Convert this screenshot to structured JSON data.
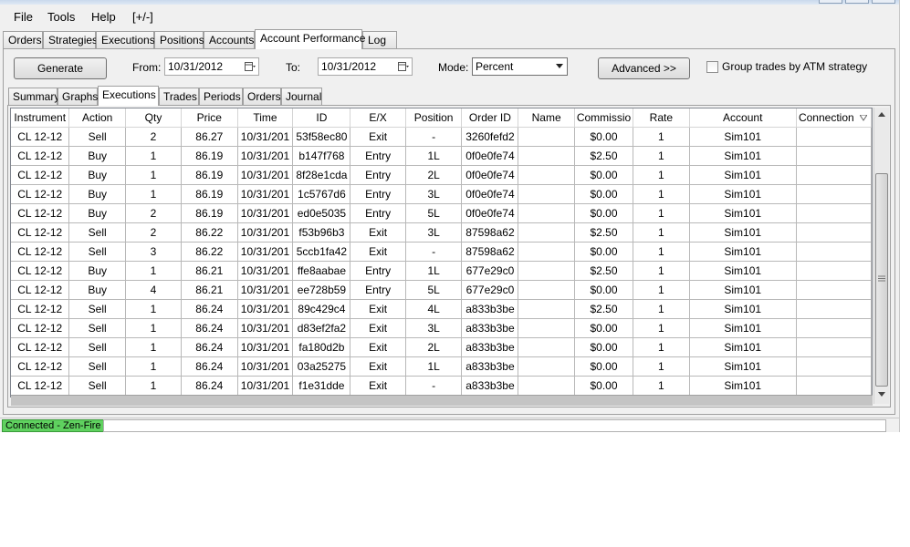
{
  "menu": [
    "File",
    "Tools",
    "Help",
    "[+/-]"
  ],
  "main_tabs": [
    "Orders",
    "Strategies",
    "Executions",
    "Positions",
    "Accounts",
    "Account Performance",
    "Log"
  ],
  "toolbar": {
    "generate_label": "Generate",
    "from_label": "From:",
    "from_value": "10/31/2012",
    "to_label": "To:",
    "to_value": "10/31/2012",
    "mode_label": "Mode:",
    "mode_value": "Percent",
    "advanced_label": "Advanced >>",
    "group_label": "Group trades by ATM strategy"
  },
  "sub_tabs": [
    "Summary",
    "Graphs",
    "Executions",
    "Trades",
    "Periods",
    "Orders",
    "Journal"
  ],
  "grid": {
    "columns": [
      "Instrument",
      "Action",
      "Qty",
      "Price",
      "Time",
      "ID",
      "E/X",
      "Position",
      "Order ID",
      "Name",
      "Commissio",
      "Rate",
      "Account",
      "Connection"
    ],
    "rows": [
      [
        "CL 12-12",
        "Sell",
        "2",
        "86.27",
        "10/31/201",
        "53f58ec80",
        "Exit",
        "-",
        "3260fefd2",
        "",
        "$0.00",
        "1",
        "Sim101",
        ""
      ],
      [
        "CL 12-12",
        "Buy",
        "1",
        "86.19",
        "10/31/201",
        "b147f768",
        "Entry",
        "1L",
        "0f0e0fe74",
        "",
        "$2.50",
        "1",
        "Sim101",
        ""
      ],
      [
        "CL 12-12",
        "Buy",
        "1",
        "86.19",
        "10/31/201",
        "8f28e1cda",
        "Entry",
        "2L",
        "0f0e0fe74",
        "",
        "$0.00",
        "1",
        "Sim101",
        ""
      ],
      [
        "CL 12-12",
        "Buy",
        "1",
        "86.19",
        "10/31/201",
        "1c5767d6",
        "Entry",
        "3L",
        "0f0e0fe74",
        "",
        "$0.00",
        "1",
        "Sim101",
        ""
      ],
      [
        "CL 12-12",
        "Buy",
        "2",
        "86.19",
        "10/31/201",
        "ed0e5035",
        "Entry",
        "5L",
        "0f0e0fe74",
        "",
        "$0.00",
        "1",
        "Sim101",
        ""
      ],
      [
        "CL 12-12",
        "Sell",
        "2",
        "86.22",
        "10/31/201",
        "f53b96b3",
        "Exit",
        "3L",
        "87598a62",
        "",
        "$2.50",
        "1",
        "Sim101",
        ""
      ],
      [
        "CL 12-12",
        "Sell",
        "3",
        "86.22",
        "10/31/201",
        "5ccb1fa42",
        "Exit",
        "-",
        "87598a62",
        "",
        "$0.00",
        "1",
        "Sim101",
        ""
      ],
      [
        "CL 12-12",
        "Buy",
        "1",
        "86.21",
        "10/31/201",
        "ffe8aabae",
        "Entry",
        "1L",
        "677e29c0",
        "",
        "$2.50",
        "1",
        "Sim101",
        ""
      ],
      [
        "CL 12-12",
        "Buy",
        "4",
        "86.21",
        "10/31/201",
        "ee728b59",
        "Entry",
        "5L",
        "677e29c0",
        "",
        "$0.00",
        "1",
        "Sim101",
        ""
      ],
      [
        "CL 12-12",
        "Sell",
        "1",
        "86.24",
        "10/31/201",
        "89c429c4",
        "Exit",
        "4L",
        "a833b3be",
        "",
        "$2.50",
        "1",
        "Sim101",
        ""
      ],
      [
        "CL 12-12",
        "Sell",
        "1",
        "86.24",
        "10/31/201",
        "d83ef2fa2",
        "Exit",
        "3L",
        "a833b3be",
        "",
        "$0.00",
        "1",
        "Sim101",
        ""
      ],
      [
        "CL 12-12",
        "Sell",
        "1",
        "86.24",
        "10/31/201",
        "fa180d2b",
        "Exit",
        "2L",
        "a833b3be",
        "",
        "$0.00",
        "1",
        "Sim101",
        ""
      ],
      [
        "CL 12-12",
        "Sell",
        "1",
        "86.24",
        "10/31/201",
        "03a25275",
        "Exit",
        "1L",
        "a833b3be",
        "",
        "$0.00",
        "1",
        "Sim101",
        ""
      ],
      [
        "CL 12-12",
        "Sell",
        "1",
        "86.24",
        "10/31/201",
        "f1e31dde",
        "Exit",
        "-",
        "a833b3be",
        "",
        "$0.00",
        "1",
        "Sim101",
        ""
      ]
    ]
  },
  "status": {
    "connection": "Connected - Zen-Fire"
  },
  "colors": {
    "connected": "#5fd15f",
    "window_bg": "#f0f0f0"
  }
}
